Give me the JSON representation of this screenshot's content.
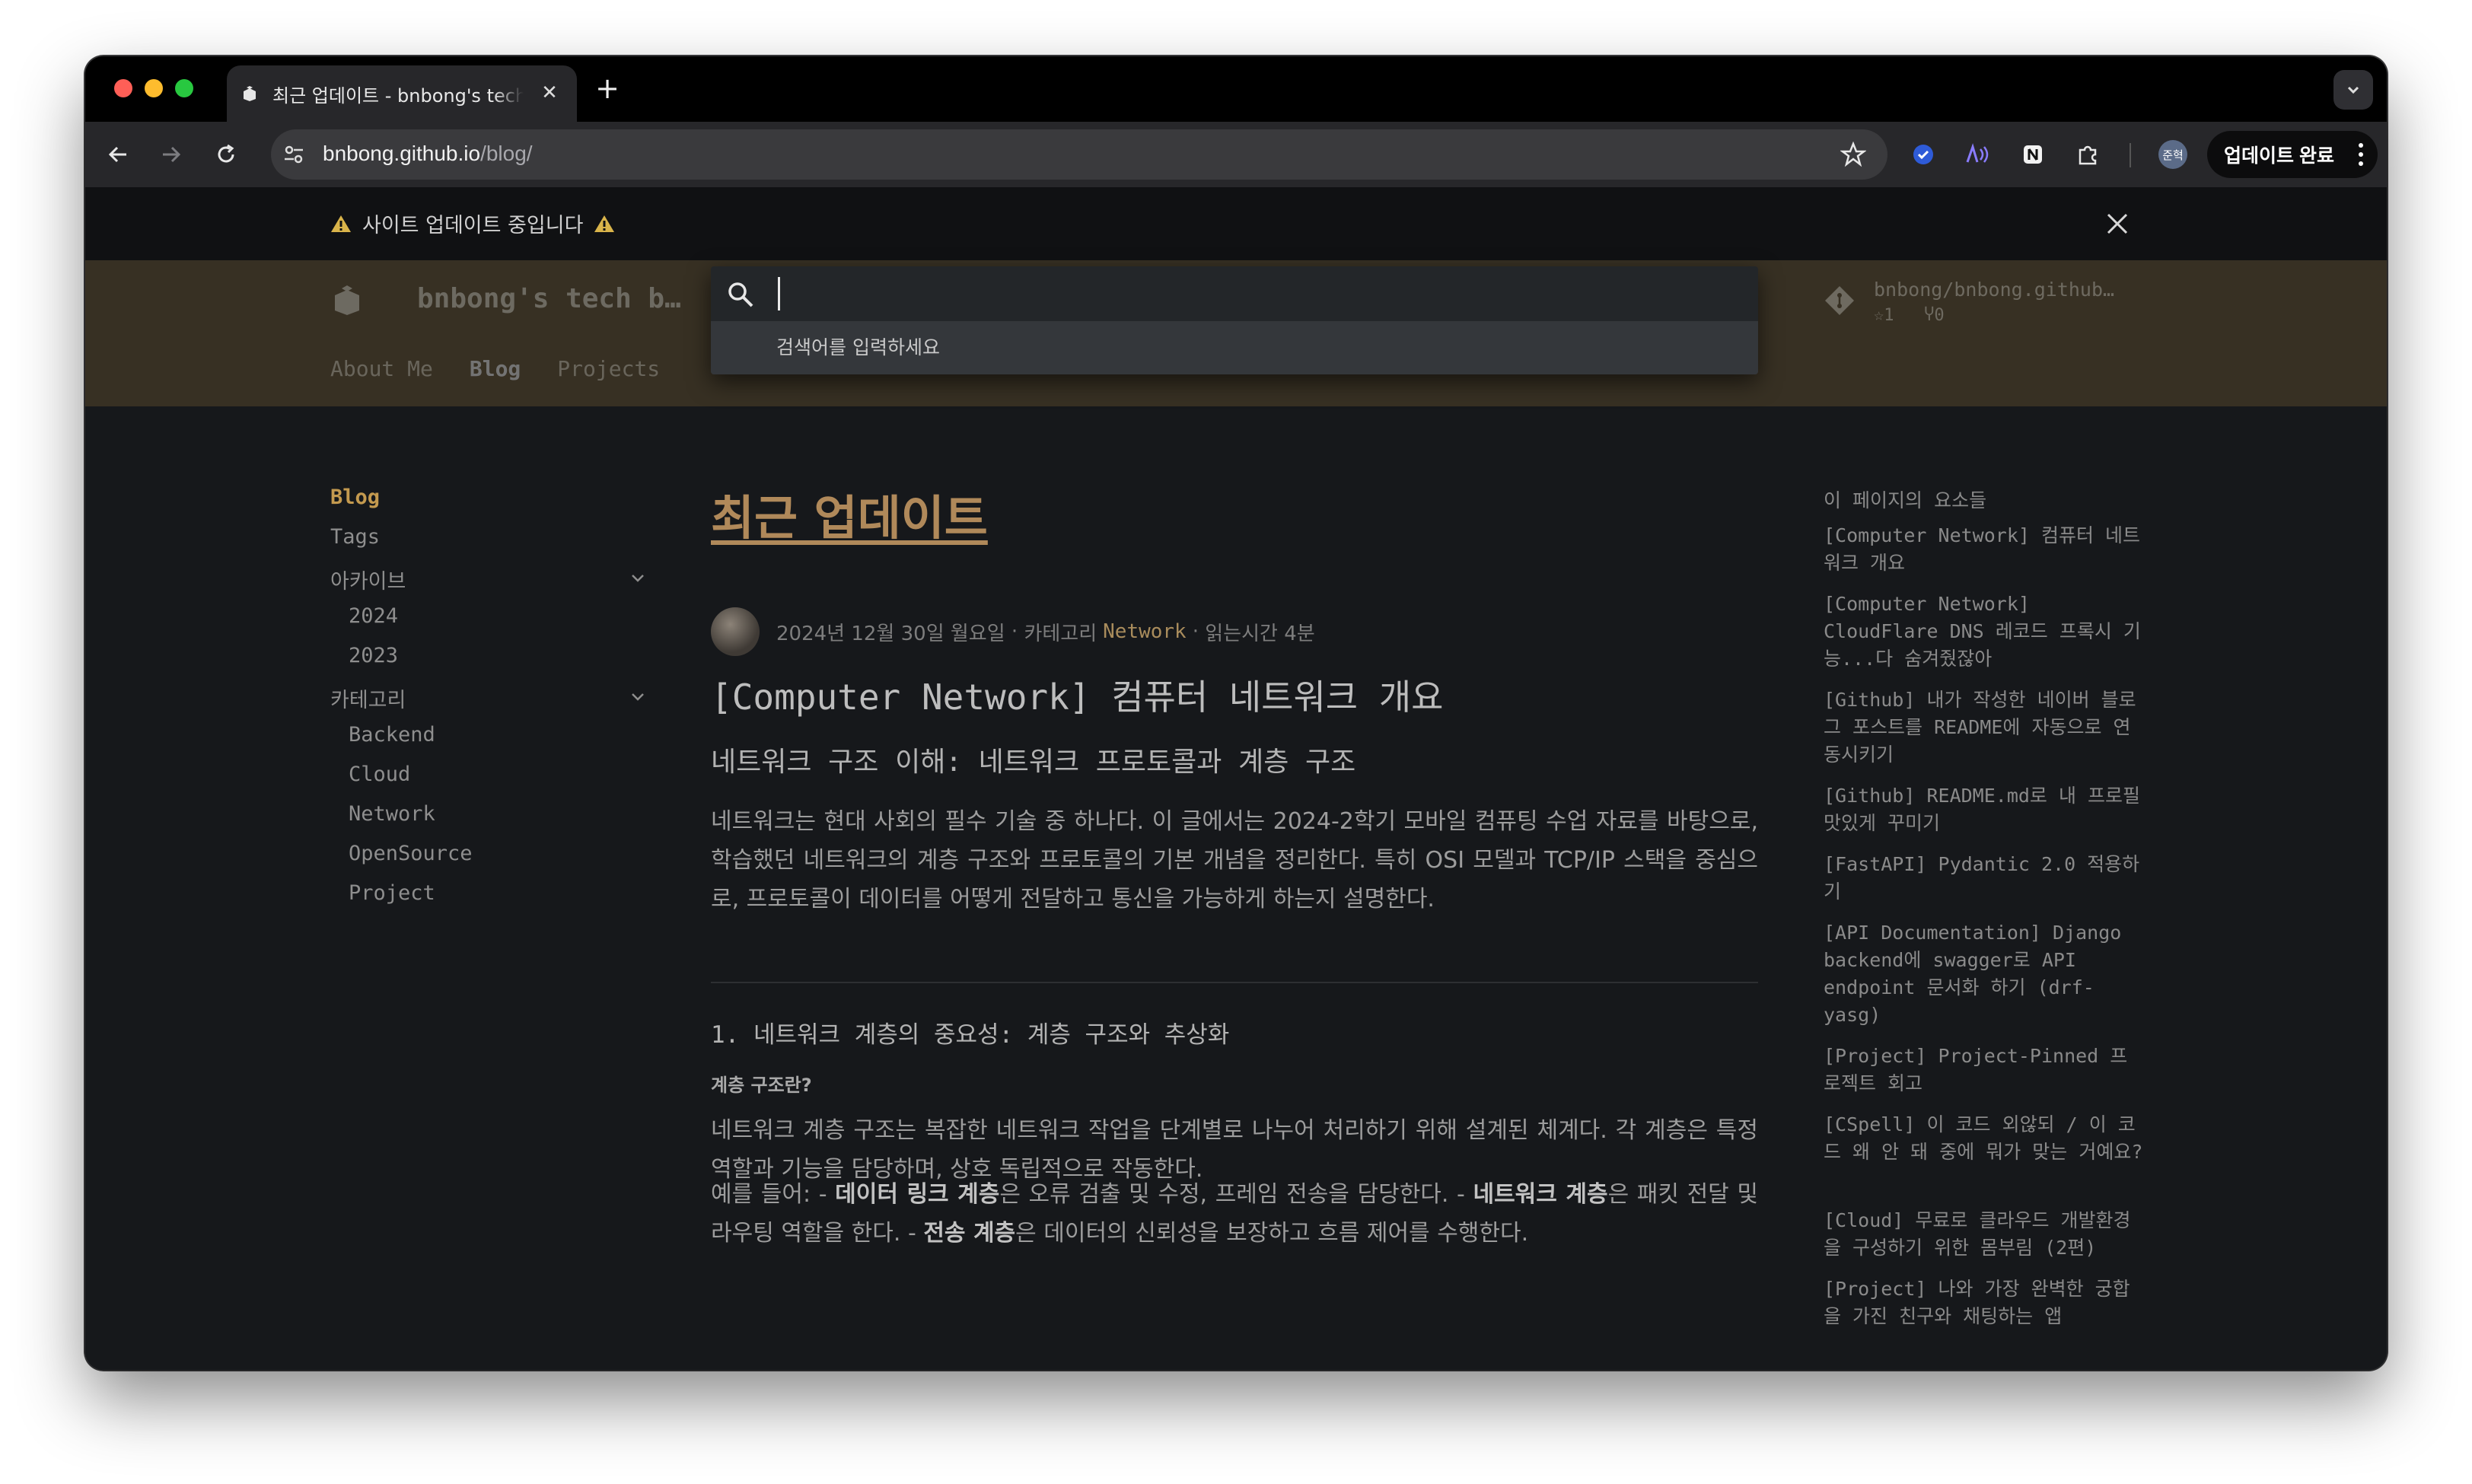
{
  "browser": {
    "tab_title": "최근 업데이트 - bnbong's tech blog",
    "url_host": "bnbong.github.io",
    "url_path": "/blog/",
    "update_button": "업데이트 완료",
    "profile_label": "준혁"
  },
  "banner": {
    "message": "사이트 업데이트 중입니다"
  },
  "header": {
    "site_name": "bnbong's tech blog",
    "nav": [
      "About Me",
      "Blog",
      "Projects"
    ],
    "repo_name": "bnbong/bnbong.github.io",
    "repo_stars": "1",
    "repo_forks": "0"
  },
  "search": {
    "placeholder": "검색어를 입력하세요"
  },
  "sidebar": {
    "blog": "Blog",
    "tags": "Tags",
    "archive": "아카이브",
    "years": [
      "2024",
      "2023"
    ],
    "category": "카테고리",
    "categories": [
      "Backend",
      "Cloud",
      "Network",
      "OpenSource",
      "Project"
    ]
  },
  "article": {
    "page_title": "최근 업데이트",
    "date": "2024년 12월 30일 월요일",
    "category_prefix": "카테고리",
    "category": "Network",
    "read_time": "읽는시간 4분",
    "post_title": "[Computer Network] 컴퓨터 네트워크 개요",
    "post_subtitle": "네트워크 구조 이해: 네트워크 프로토콜과 계층 구조",
    "intro": "네트워크는 현대 사회의 필수 기술 중 하나다. 이 글에서는 2024-2학기 모바일 컴퓨팅 수업 자료를 바탕으로, 학습했던 네트워크의 계층 구조와 프로토콜의 기본 개념을 정리한다. 특히 OSI 모델과 TCP/IP 스택을 중심으로, 프로토콜이 데이터를 어떻게 전달하고 통신을 가능하게 하는지 설명한다.",
    "section1": "1. 네트워크 계층의 중요성: 계층 구조와 추상화",
    "section1_sub": "계층 구조란?",
    "para2": "네트워크 계층 구조는 복잡한 네트워크 작업을 단계별로 나누어 처리하기 위해 설계된 체계다. 각 계층은 특정 역할과 기능을 담당하며, 상호 독립적으로 작동한다.",
    "para3_a": "예를 들어: - ",
    "para3_b1": "데이터 링크 계층",
    "para3_c1": "은 오류 검출 및 수정, 프레임 전송을 담당한다. - ",
    "para3_b2": "네트워크 계층",
    "para3_c2": "은 패킷 전달 및 라우팅 역할을 한다. - ",
    "para3_b3": "전송 계층",
    "para3_c3": "은 데이터의 신뢰성을 보장하고 흐름 제어를 수행한다."
  },
  "toc": {
    "title": "이 페이지의 요소들",
    "items": [
      "[Computer Network] 컴퓨터 네트워크 개요",
      "[Computer Network] CloudFlare DNS 레코드 프록시 기능...다 숨겨줬잖아",
      "[Github] 내가 작성한 네이버 블로그 포스트를 README에 자동으로 연동시키기",
      "[Github] README.md로 내 프로필 맛있게 꾸미기",
      "[FastAPI] Pydantic 2.0 적용하기",
      "[API Documentation] Django backend에 swagger로 API endpoint 문서화 하기 (drf-yasg)",
      "[Project] Project-Pinned 프로젝트 회고",
      "[CSpell] 이 코드 외않되 / 이 코드 왜 안 돼 중에 뭐가 맞는 거예요?",
      "[Cloud] 무료로 클라우드 개발환경을 구성하기 위한 몸부림 (2편)",
      "[Project] 나와 가장 완벽한 궁합을 가진 친구와 채팅하는 앱"
    ]
  },
  "colors": {
    "header_brown": "#7a6a4f",
    "accent_gold": "#c49a4f",
    "page_bg": "#16181b"
  }
}
